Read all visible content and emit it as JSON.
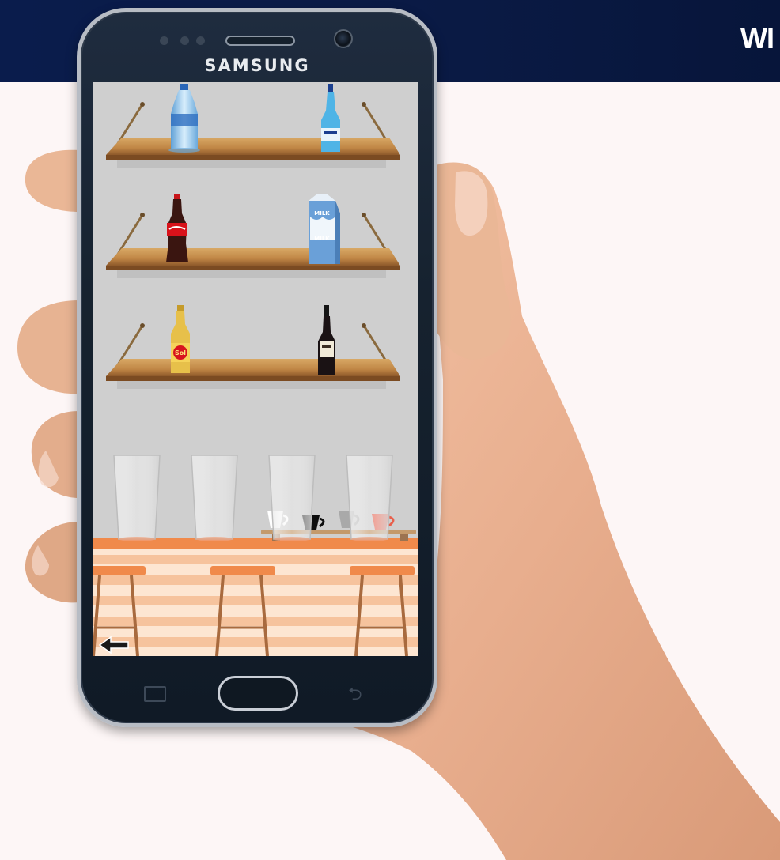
{
  "banner": {
    "text": "WI"
  },
  "phone": {
    "brand": "SAMSUNG"
  },
  "game": {
    "shelves": [
      {
        "left_item": "water-bottle",
        "right_item": "blue-soda-bottle"
      },
      {
        "left_item": "cola-bottle",
        "right_item": "milk-carton"
      },
      {
        "left_item": "beer-bottle",
        "right_item": "wine-bottle"
      }
    ],
    "milk_label": "MILK",
    "beer_label": "Sol",
    "glasses": [
      "glass",
      "glass",
      "glass",
      "glass"
    ],
    "cups": [
      "white-cup",
      "black-cup",
      "grey-cup",
      "red-cup"
    ],
    "stools": 3,
    "back_icon": "back-arrow-icon",
    "colors": {
      "wall": "#cfcfcf",
      "counter_orange": "#f08a4b",
      "stripe_light": "#fde6d2",
      "stripe_dark": "#f6c39d",
      "shelf_wood": "#c8914f",
      "cup_red": "#e8604c"
    }
  }
}
